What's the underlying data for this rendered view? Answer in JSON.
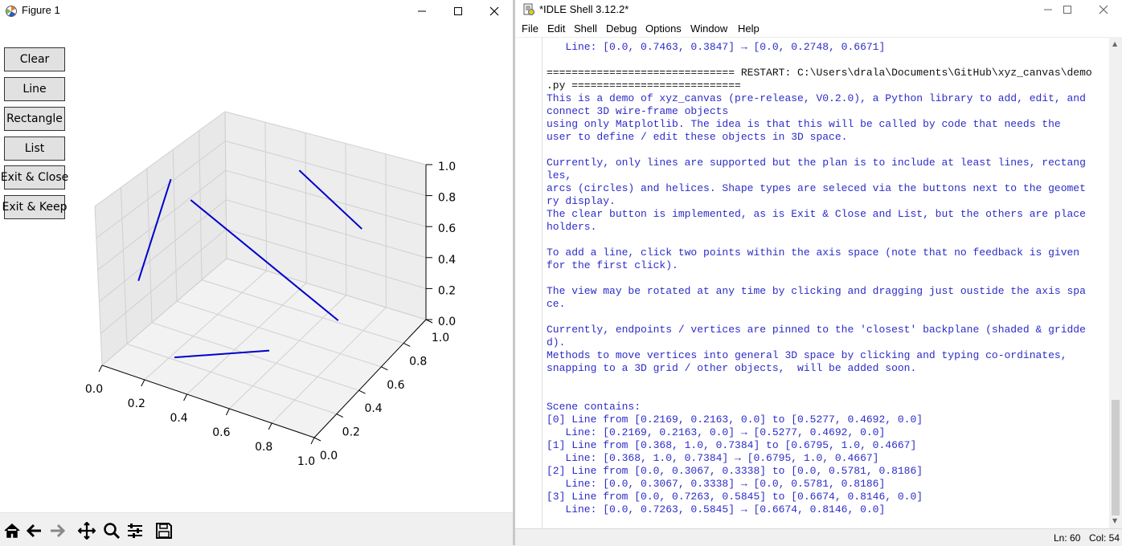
{
  "figure_window": {
    "title": "Figure 1",
    "buttons": [
      "Clear",
      "Line",
      "Rectangle",
      "List",
      "Exit & Close",
      "Exit & Keep"
    ],
    "axes": {
      "x_ticks": [
        "0.0",
        "0.2",
        "0.4",
        "0.6",
        "0.8",
        "1.0"
      ],
      "y_ticks": [
        "0.0",
        "0.2",
        "0.4",
        "0.6",
        "0.8",
        "1.0"
      ],
      "z_ticks": [
        "0.0",
        "0.2",
        "0.4",
        "0.6",
        "0.8",
        "1.0"
      ],
      "line_color": "#0000cc",
      "pane_color": "#f2f2f2",
      "grid_color": "#d0d0d0"
    },
    "lines": [
      {
        "from": [
          0.2169,
          0.2163,
          0.0
        ],
        "to": [
          0.5277,
          0.4692,
          0.0
        ]
      },
      {
        "from": [
          0.368,
          1.0,
          0.7384
        ],
        "to": [
          0.6795,
          1.0,
          0.4667
        ]
      },
      {
        "from": [
          0.0,
          0.3067,
          0.3338
        ],
        "to": [
          0.0,
          0.5781,
          0.8186
        ]
      },
      {
        "from": [
          0.0,
          0.7263,
          0.5845
        ],
        "to": [
          0.6674,
          0.8146,
          0.0
        ]
      }
    ],
    "toolbar": [
      "home-icon",
      "back-icon",
      "forward-icon",
      "pan-icon",
      "zoom-icon",
      "configure-icon",
      "save-icon"
    ]
  },
  "idle_window": {
    "title": "*IDLE Shell 3.12.2*",
    "menus": [
      "File",
      "Edit",
      "Shell",
      "Debug",
      "Options",
      "Window",
      "Help"
    ],
    "lines": [
      {
        "t": "   Line: [0.0, 0.7463, 0.3847] → [0.0, 0.2748, 0.6671]",
        "c": "blue"
      },
      {
        "t": "",
        "c": "blue"
      },
      {
        "t": "============================== RESTART: C:\\Users\\drala\\Documents\\GitHub\\xyz_canvas\\demo",
        "c": "black"
      },
      {
        "t": ".py ===========================",
        "c": "black"
      },
      {
        "t": "This is a demo of xyz_canvas (pre-release, V0.2.0), a Python library to add, edit, and",
        "c": "blue"
      },
      {
        "t": "connect 3D wire-frame objects",
        "c": "blue"
      },
      {
        "t": "using only Matplotlib. The idea is that this will be called by code that needs the",
        "c": "blue"
      },
      {
        "t": "user to define / edit these objects in 3D space.",
        "c": "blue"
      },
      {
        "t": "",
        "c": "blue"
      },
      {
        "t": "Currently, only lines are supported but the plan is to include at least lines, rectang",
        "c": "blue"
      },
      {
        "t": "les,",
        "c": "blue"
      },
      {
        "t": "arcs (circles) and helices. Shape types are seleced via the buttons next to the geomet",
        "c": "blue"
      },
      {
        "t": "ry display.",
        "c": "blue"
      },
      {
        "t": "The clear button is implemented, as is Exit & Close and List, but the others are place",
        "c": "blue"
      },
      {
        "t": "holders.",
        "c": "blue"
      },
      {
        "t": "",
        "c": "blue"
      },
      {
        "t": "To add a line, click two points within the axis space (note that no feedback is given",
        "c": "blue"
      },
      {
        "t": "for the first click).",
        "c": "blue"
      },
      {
        "t": "",
        "c": "blue"
      },
      {
        "t": "The view may be rotated at any time by clicking and dragging just oustide the axis spa",
        "c": "blue"
      },
      {
        "t": "ce.",
        "c": "blue"
      },
      {
        "t": "",
        "c": "blue"
      },
      {
        "t": "Currently, endpoints / vertices are pinned to the 'closest' backplane (shaded & gridde",
        "c": "blue"
      },
      {
        "t": "d).",
        "c": "blue"
      },
      {
        "t": "Methods to move vertices into general 3D space by clicking and typing co-ordinates,",
        "c": "blue"
      },
      {
        "t": "snapping to a 3D grid / other objects,  will be added soon.",
        "c": "blue"
      },
      {
        "t": "",
        "c": "blue"
      },
      {
        "t": "",
        "c": "blue"
      },
      {
        "t": "Scene contains:",
        "c": "blue"
      },
      {
        "t": "[0] Line from [0.2169, 0.2163, 0.0] to [0.5277, 0.4692, 0.0]",
        "c": "blue"
      },
      {
        "t": "   Line: [0.2169, 0.2163, 0.0] → [0.5277, 0.4692, 0.0]",
        "c": "blue"
      },
      {
        "t": "[1] Line from [0.368, 1.0, 0.7384] to [0.6795, 1.0, 0.4667]",
        "c": "blue"
      },
      {
        "t": "   Line: [0.368, 1.0, 0.7384] → [0.6795, 1.0, 0.4667]",
        "c": "blue"
      },
      {
        "t": "[2] Line from [0.0, 0.3067, 0.3338] to [0.0, 0.5781, 0.8186]",
        "c": "blue"
      },
      {
        "t": "   Line: [0.0, 0.3067, 0.3338] → [0.0, 0.5781, 0.8186]",
        "c": "blue"
      },
      {
        "t": "[3] Line from [0.0, 0.7263, 0.5845] to [0.6674, 0.8146, 0.0]",
        "c": "blue"
      },
      {
        "t": "   Line: [0.0, 0.7263, 0.5845] → [0.6674, 0.8146, 0.0]",
        "c": "blue"
      }
    ],
    "status": {
      "ln": "Ln: 60",
      "col": "Col: 54"
    }
  }
}
